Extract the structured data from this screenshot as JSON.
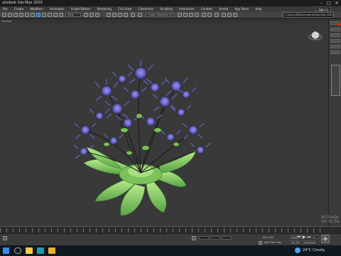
{
  "window": {
    "title": "utodesk 3ds Max 2020",
    "minimize": "–",
    "maximize": "□",
    "close": "✕",
    "sign_in": "Sign In"
  },
  "menu": {
    "items": [
      "File",
      "Create",
      "Modifiers",
      "Animation",
      "Graph Editors",
      "Rendering",
      "Civil View",
      "Customize",
      "Scripting",
      "Interactive",
      "Content",
      "Arnold",
      "App Store",
      "Help"
    ]
  },
  "toolbar": {
    "filter_select": "View",
    "selection_set": "Create Selection Se",
    "project_path": "C:\\Users\\EN\\Documents\\3ds Max 2020"
  },
  "viewport": {
    "label": "Shading"
  },
  "status": {
    "add_time_tag": "Add Time Tag",
    "auto_key": "Auto Key",
    "set_key": "Set Key",
    "key_mode": "Selected",
    "frame_value": "0",
    "coords": "0/0 / 0/0"
  },
  "activation": {
    "line1": "Activate",
    "line2": "Go to Se"
  },
  "taskbar": {
    "weather": "24°C Cloudy",
    "icons": [
      "windows-icon",
      "search-icon",
      "file-explorer-icon",
      "3dsmax-icon",
      "folder-icon"
    ]
  },
  "colors": {
    "accent": "#2f6fb3",
    "flower_head": "#6a64c8",
    "leaf": "#8ed06a"
  }
}
